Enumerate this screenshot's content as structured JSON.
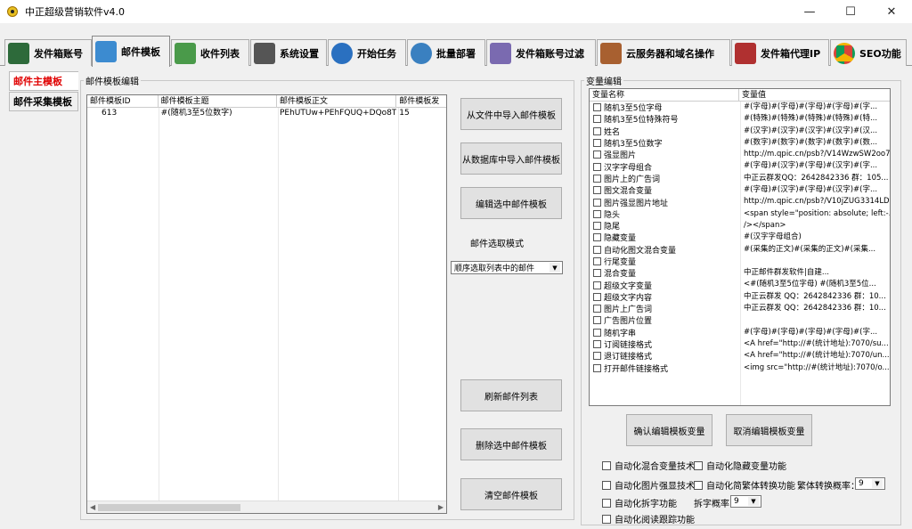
{
  "window": {
    "title": "中正超级营销软件v4.0",
    "controls": {
      "minimize": "—",
      "maximize": "☐",
      "close": "✕"
    }
  },
  "tabs": [
    {
      "label": "发件箱账号",
      "icon": "mailbox-icon",
      "color": "#2d6a3a"
    },
    {
      "label": "邮件模板",
      "icon": "pen-icon",
      "color": "#3c8bd0",
      "active": true
    },
    {
      "label": "收件列表",
      "icon": "download-folder-icon",
      "color": "#4a9a4a"
    },
    {
      "label": "系统设置",
      "icon": "tools-icon",
      "color": "#555555"
    },
    {
      "label": "开始任务",
      "icon": "globe-icon",
      "color": "#2a70c0"
    },
    {
      "label": "批量部署",
      "icon": "user-globe-icon",
      "color": "#3a80c0"
    },
    {
      "label": "发件箱账号过滤",
      "icon": "filter-folder-icon",
      "color": "#7a6ab0"
    },
    {
      "label": "云服务器和域名操作",
      "icon": "drink-icon",
      "color": "#a86030"
    },
    {
      "label": "发件箱代理IP",
      "icon": "proxy-icon",
      "color": "#b03030"
    },
    {
      "label": "SEO功能",
      "icon": "chrome-icon",
      "color": "#db4437"
    }
  ],
  "side_tabs": [
    {
      "label": "邮件主模板",
      "active": true
    },
    {
      "label": "邮件采集模板"
    }
  ],
  "template_group": {
    "label": "邮件模板编辑",
    "columns": [
      "邮件模板ID",
      "邮件模板主题",
      "邮件模板正文",
      "邮件模板发"
    ],
    "rows": [
      [
        "613",
        "#(随机3至5位数字)",
        "PEhUTUw+PEhFQUQ+DQo8TU...",
        "15"
      ]
    ]
  },
  "buttons": {
    "import_file": "从文件中导入邮件模板",
    "import_db": "从数据库中导入邮件模板",
    "edit_selected": "编辑选中邮件模板",
    "refresh_list": "刷新邮件列表",
    "delete_selected": "删除选中邮件模板",
    "clear_all": "清空邮件模板",
    "confirm_vars": "确认编辑模板变量",
    "cancel_vars": "取消编辑模板变量"
  },
  "select_mode": {
    "label": "邮件选取模式",
    "value": "顺序选取列表中的邮件"
  },
  "variable_group": {
    "label": "变量编辑",
    "columns": [
      "变量名称",
      "变量值"
    ],
    "rows": [
      [
        "随机3至5位字母",
        "#(字母)#(字母)#(字母)#(字母)#(字..."
      ],
      [
        "随机3至5位特殊符号",
        "#(特殊)#(特殊)#(特殊)#(特殊)#(特..."
      ],
      [
        "姓名",
        "#(汉字)#(汉字)#(汉字)#(汉字)#(汉..."
      ],
      [
        "随机3至5位数字",
        "#(数字)#(数字)#(数字)#(数字)#(数..."
      ],
      [
        "强显图片",
        "http://m.qpic.cn/psb?/V14WzwSW2oo7..."
      ],
      [
        "汉字字母组合",
        "#(字母)#(汉字)#(字母)#(汉字)#(字..."
      ],
      [
        "图片上的广告词",
        "中正云群发QQ：2642842336 群：105..."
      ],
      [
        "图文混合变量",
        "#(字母)#(汉字)#(字母)#(汉字)#(字..."
      ],
      [
        "图片强显图片地址",
        "http://m.qpic.cn/psb?/V10jZUG3314LDz..."
      ],
      [
        "隐头",
        "<span style=\"position: absolute; left:-..."
      ],
      [
        "隐尾",
        "/></span>"
      ],
      [
        "隐藏变量",
        "#(汉字字母组合)"
      ],
      [
        "自动化图文混合变量",
        "#(采集的正文)#(采集的正文)#(采集..."
      ],
      [
        "行尾变量",
        ""
      ],
      [
        "混合变量",
        "中正邮件群发软件|自建..."
      ],
      [
        "超级文字变量",
        "<#(随机3至5位字母) #(随机3至5位..."
      ],
      [
        "超级文字内容",
        "中正云群发 QQ：2642842336 群：10..."
      ],
      [
        "图片上广告词",
        "中正云群发 QQ：2642842336 群：10..."
      ],
      [
        "广告图片位置",
        ""
      ],
      [
        "随机字串",
        "#(字母)#(字母)#(字母)#(字母)#(字..."
      ],
      [
        "订阅链接格式",
        "<A href=\"http://#(统计地址):7070/su..."
      ],
      [
        "退订链接格式",
        "<A href=\"http://#(统计地址):7070/un..."
      ],
      [
        "打开邮件链接格式",
        "<img src=\"http://#(统计地址):7070/o..."
      ]
    ]
  },
  "options": {
    "auto_mix": "自动化混合变量技术",
    "auto_hide": "自动化隐藏变量功能",
    "auto_img": "自动化图片强显技术",
    "auto_trad": "自动化简繁体转换功能",
    "trad_rate_label": "繁体转换概率：",
    "trad_rate_value": "9",
    "auto_split": "自动化拆字功能",
    "split_rate_label": "拆字概率：",
    "split_rate_value": "9",
    "auto_track": "自动化阅读跟踪功能"
  }
}
